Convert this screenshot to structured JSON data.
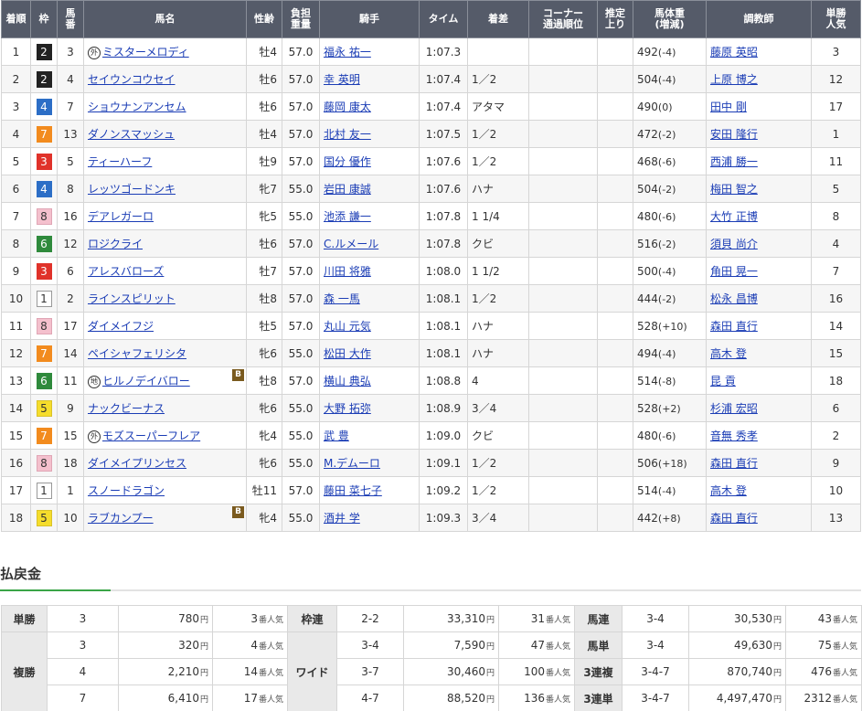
{
  "columns": {
    "rank": "着順",
    "waku": "枠",
    "umaban": "馬\n番",
    "horse": "馬名",
    "sexage": "性齢",
    "weight": "負担\n重量",
    "jockey": "騎手",
    "time": "タイム",
    "margin": "着差",
    "corner": "コーナー\n通過順位",
    "last3f": "推定\n上り",
    "bodyweight": "馬体重\n(増減)",
    "trainer": "調教師",
    "odds": "単勝\n人気"
  },
  "results": [
    {
      "rank": "1",
      "waku": "2",
      "umaban": "3",
      "mark": "外",
      "horse": "ミスターメロディ",
      "blinker": "",
      "sexage": "牡4",
      "weight": "57.0",
      "jockey": "福永 祐一",
      "time": "1:07.3",
      "margin": "",
      "bw": "492",
      "bwd": "(-4)",
      "trainer": "藤原 英昭",
      "pop": "3"
    },
    {
      "rank": "2",
      "waku": "2",
      "umaban": "4",
      "mark": "",
      "horse": "セイウンコウセイ",
      "blinker": "",
      "sexage": "牡6",
      "weight": "57.0",
      "jockey": "幸 英明",
      "time": "1:07.4",
      "margin": "1／2",
      "bw": "504",
      "bwd": "(-4)",
      "trainer": "上原 博之",
      "pop": "12"
    },
    {
      "rank": "3",
      "waku": "4",
      "umaban": "7",
      "mark": "",
      "horse": "ショウナンアンセム",
      "blinker": "",
      "sexage": "牡6",
      "weight": "57.0",
      "jockey": "藤岡 康太",
      "time": "1:07.4",
      "margin": "アタマ",
      "bw": "490",
      "bwd": "(0)",
      "trainer": "田中 剛",
      "pop": "17"
    },
    {
      "rank": "4",
      "waku": "7",
      "umaban": "13",
      "mark": "",
      "horse": "ダノンスマッシュ",
      "blinker": "",
      "sexage": "牡4",
      "weight": "57.0",
      "jockey": "北村 友一",
      "time": "1:07.5",
      "margin": "1／2",
      "bw": "472",
      "bwd": "(-2)",
      "trainer": "安田 隆行",
      "pop": "1"
    },
    {
      "rank": "5",
      "waku": "3",
      "umaban": "5",
      "mark": "",
      "horse": "ティーハーフ",
      "blinker": "",
      "sexage": "牡9",
      "weight": "57.0",
      "jockey": "国分 優作",
      "time": "1:07.6",
      "margin": "1／2",
      "bw": "468",
      "bwd": "(-6)",
      "trainer": "西浦 勝一",
      "pop": "11"
    },
    {
      "rank": "6",
      "waku": "4",
      "umaban": "8",
      "mark": "",
      "horse": "レッツゴードンキ",
      "blinker": "",
      "sexage": "牝7",
      "weight": "55.0",
      "jockey": "岩田 康誠",
      "time": "1:07.6",
      "margin": "ハナ",
      "bw": "504",
      "bwd": "(-2)",
      "trainer": "梅田 智之",
      "pop": "5"
    },
    {
      "rank": "7",
      "waku": "8",
      "umaban": "16",
      "mark": "",
      "horse": "デアレガーロ",
      "blinker": "",
      "sexage": "牝5",
      "weight": "55.0",
      "jockey": "池添 謙一",
      "time": "1:07.8",
      "margin": "1 1/4",
      "bw": "480",
      "bwd": "(-6)",
      "trainer": "大竹 正博",
      "pop": "8"
    },
    {
      "rank": "8",
      "waku": "6",
      "umaban": "12",
      "mark": "",
      "horse": "ロジクライ",
      "blinker": "",
      "sexage": "牡6",
      "weight": "57.0",
      "jockey": "C.ルメール",
      "time": "1:07.8",
      "margin": "クビ",
      "bw": "516",
      "bwd": "(-2)",
      "trainer": "須貝 尚介",
      "pop": "4"
    },
    {
      "rank": "9",
      "waku": "3",
      "umaban": "6",
      "mark": "",
      "horse": "アレスバローズ",
      "blinker": "",
      "sexage": "牡7",
      "weight": "57.0",
      "jockey": "川田 将雅",
      "time": "1:08.0",
      "margin": "1 1/2",
      "bw": "500",
      "bwd": "(-4)",
      "trainer": "角田 晃一",
      "pop": "7"
    },
    {
      "rank": "10",
      "waku": "1",
      "umaban": "2",
      "mark": "",
      "horse": "ラインスピリット",
      "blinker": "",
      "sexage": "牡8",
      "weight": "57.0",
      "jockey": "森 一馬",
      "time": "1:08.1",
      "margin": "1／2",
      "bw": "444",
      "bwd": "(-2)",
      "trainer": "松永 昌博",
      "pop": "16"
    },
    {
      "rank": "11",
      "waku": "8",
      "umaban": "17",
      "mark": "",
      "horse": "ダイメイフジ",
      "blinker": "",
      "sexage": "牡5",
      "weight": "57.0",
      "jockey": "丸山 元気",
      "time": "1:08.1",
      "margin": "ハナ",
      "bw": "528",
      "bwd": "(+10)",
      "trainer": "森田 直行",
      "pop": "14"
    },
    {
      "rank": "12",
      "waku": "7",
      "umaban": "14",
      "mark": "",
      "horse": "ペイシャフェリシタ",
      "blinker": "",
      "sexage": "牝6",
      "weight": "55.0",
      "jockey": "松田 大作",
      "time": "1:08.1",
      "margin": "ハナ",
      "bw": "494",
      "bwd": "(-4)",
      "trainer": "高木 登",
      "pop": "15"
    },
    {
      "rank": "13",
      "waku": "6",
      "umaban": "11",
      "mark": "地",
      "horse": "ヒルノデイバロー",
      "blinker": "B",
      "sexage": "牡8",
      "weight": "57.0",
      "jockey": "横山 典弘",
      "time": "1:08.8",
      "margin": "4",
      "bw": "514",
      "bwd": "(-8)",
      "trainer": "昆 貢",
      "pop": "18"
    },
    {
      "rank": "14",
      "waku": "5",
      "umaban": "9",
      "mark": "",
      "horse": "ナックビーナス",
      "blinker": "",
      "sexage": "牝6",
      "weight": "55.0",
      "jockey": "大野 拓弥",
      "time": "1:08.9",
      "margin": "3／4",
      "bw": "528",
      "bwd": "(+2)",
      "trainer": "杉浦 宏昭",
      "pop": "6"
    },
    {
      "rank": "15",
      "waku": "7",
      "umaban": "15",
      "mark": "外",
      "horse": "モズスーパーフレア",
      "blinker": "",
      "sexage": "牝4",
      "weight": "55.0",
      "jockey": "武 豊",
      "time": "1:09.0",
      "margin": "クビ",
      "bw": "480",
      "bwd": "(-6)",
      "trainer": "音無 秀孝",
      "pop": "2"
    },
    {
      "rank": "16",
      "waku": "8",
      "umaban": "18",
      "mark": "",
      "horse": "ダイメイプリンセス",
      "blinker": "",
      "sexage": "牝6",
      "weight": "55.0",
      "jockey": "M.デムーロ",
      "time": "1:09.1",
      "margin": "1／2",
      "bw": "506",
      "bwd": "(+18)",
      "trainer": "森田 直行",
      "pop": "9"
    },
    {
      "rank": "17",
      "waku": "1",
      "umaban": "1",
      "mark": "",
      "horse": "スノードラゴン",
      "blinker": "",
      "sexage": "牡11",
      "weight": "57.0",
      "jockey": "藤田 菜七子",
      "time": "1:09.2",
      "margin": "1／2",
      "bw": "514",
      "bwd": "(-4)",
      "trainer": "高木 登",
      "pop": "10"
    },
    {
      "rank": "18",
      "waku": "5",
      "umaban": "10",
      "mark": "",
      "horse": "ラブカンプー",
      "blinker": "B",
      "sexage": "牝4",
      "weight": "55.0",
      "jockey": "酒井 学",
      "time": "1:09.3",
      "margin": "3／4",
      "bw": "442",
      "bwd": "(+8)",
      "trainer": "森田 直行",
      "pop": "13"
    }
  ],
  "payout": {
    "title": "払戻金",
    "yen_unit": "円",
    "pop_unit": "番人気",
    "tansho": {
      "label": "単勝",
      "combo": "3",
      "amount": "780",
      "pop": "3"
    },
    "fukusho": {
      "label": "複勝",
      "rows": [
        {
          "combo": "3",
          "amount": "320",
          "pop": "4"
        },
        {
          "combo": "4",
          "amount": "2,210",
          "pop": "14"
        },
        {
          "combo": "7",
          "amount": "6,410",
          "pop": "17"
        }
      ]
    },
    "wakuren": {
      "label": "枠連",
      "combo": "2-2",
      "amount": "33,310",
      "pop": "31"
    },
    "wide": {
      "label": "ワイド",
      "rows": [
        {
          "combo": "3-4",
          "amount": "7,590",
          "pop": "47"
        },
        {
          "combo": "3-7",
          "amount": "30,460",
          "pop": "100"
        },
        {
          "combo": "4-7",
          "amount": "88,520",
          "pop": "136"
        }
      ]
    },
    "umaren": {
      "label": "馬連",
      "combo": "3-4",
      "amount": "30,530",
      "pop": "43"
    },
    "umatan": {
      "label": "馬単",
      "combo": "3-4",
      "amount": "49,630",
      "pop": "75"
    },
    "sanrenpuku": {
      "label": "3連複",
      "combo": "3-4-7",
      "amount": "870,740",
      "pop": "476"
    },
    "sanrentan": {
      "label": "3連単",
      "combo": "3-4-7",
      "amount": "4,497,470",
      "pop": "2312"
    }
  }
}
